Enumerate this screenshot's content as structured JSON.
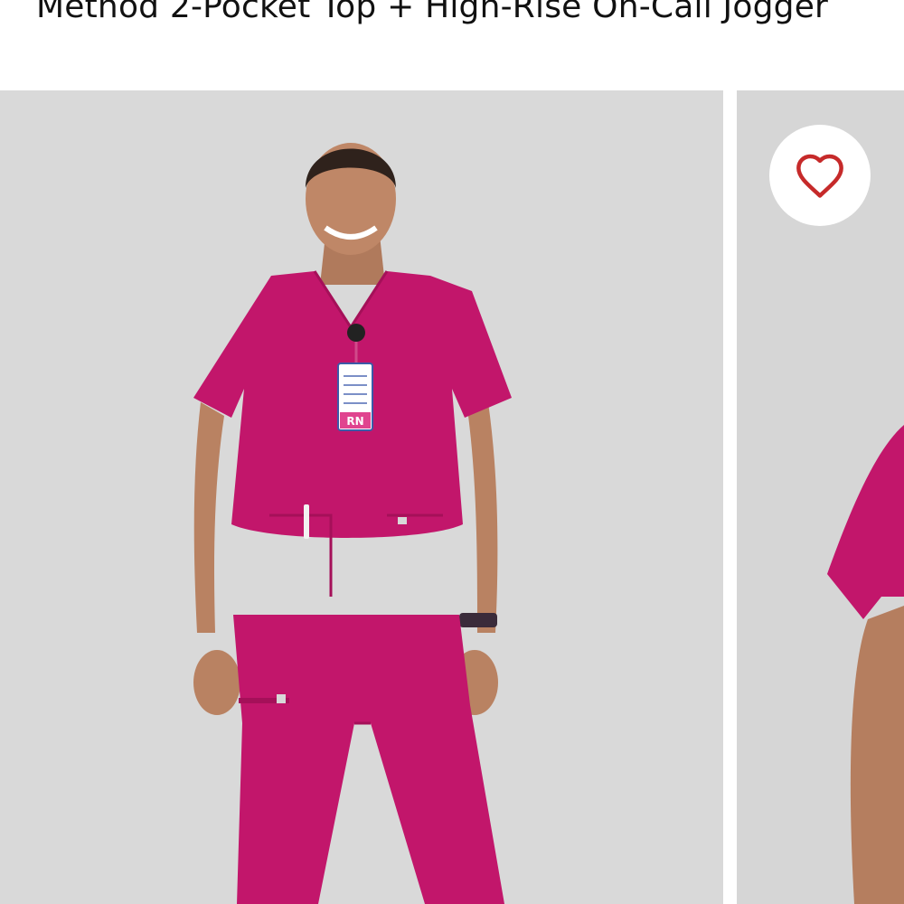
{
  "product": {
    "title": "Method 2-Pocket Top + High-Rise On-Call Jogger"
  },
  "gallery": {
    "badge_text": "RN",
    "icons": {
      "wishlist": "heart-outline-icon"
    },
    "colors": {
      "background": "#d9d9d9",
      "garment": "#c2166b",
      "wishlist_icon": "#c62a2a"
    }
  }
}
